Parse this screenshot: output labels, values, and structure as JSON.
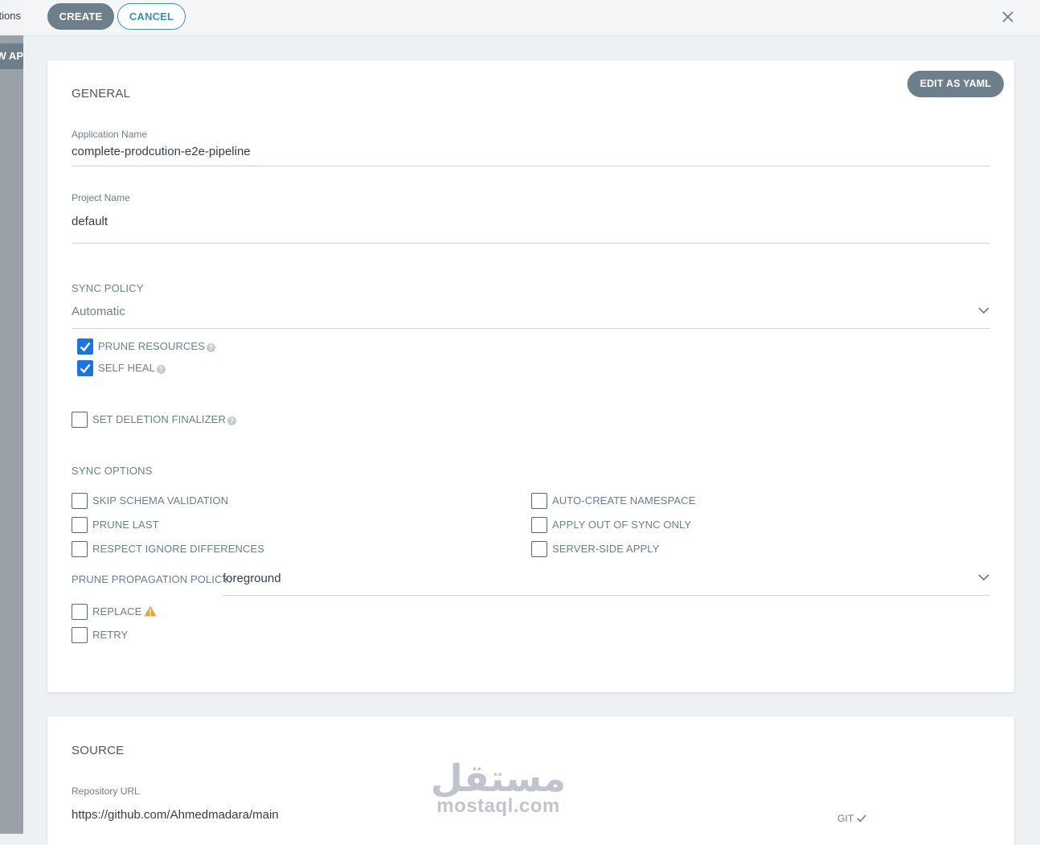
{
  "sidebar": {
    "top_text": "tions",
    "button_text": "W AP"
  },
  "toolbar": {
    "create_label": "CREATE",
    "cancel_label": "CANCEL"
  },
  "general": {
    "title": "GENERAL",
    "edit_yaml_label": "EDIT AS YAML",
    "application_name": {
      "label": "Application Name",
      "value": "complete-prodcution-e2e-pipeline"
    },
    "project_name": {
      "label": "Project Name",
      "value": "default"
    },
    "sync_policy": {
      "title": "SYNC POLICY",
      "selected": "Automatic",
      "prune_resources": {
        "label": "PRUNE RESOURCES",
        "checked": true
      },
      "self_heal": {
        "label": "SELF HEAL",
        "checked": true
      }
    },
    "set_deletion_finalizer": {
      "label": "SET DELETION FINALIZER",
      "checked": false
    },
    "sync_options": {
      "title": "SYNC OPTIONS",
      "left": [
        {
          "label": "SKIP SCHEMA VALIDATION",
          "checked": false
        },
        {
          "label": "PRUNE LAST",
          "checked": false
        },
        {
          "label": "RESPECT IGNORE DIFFERENCES",
          "checked": false
        }
      ],
      "right": [
        {
          "label": "AUTO-CREATE NAMESPACE",
          "checked": false
        },
        {
          "label": "APPLY OUT OF SYNC ONLY",
          "checked": false
        },
        {
          "label": "SERVER-SIDE APPLY",
          "checked": false
        }
      ],
      "prune_propagation": {
        "label": "PRUNE PROPAGATION POLICY:",
        "value": "foreground"
      },
      "replace": {
        "label": "REPLACE",
        "checked": false
      },
      "retry": {
        "label": "RETRY",
        "checked": false
      }
    }
  },
  "source": {
    "title": "SOURCE",
    "repository_url": {
      "label": "Repository URL",
      "value": "https://github.com/Ahmedmadara/main"
    },
    "type_label": "GIT"
  },
  "watermark": {
    "arabic": "مستقل",
    "latin": "mostaql.com"
  },
  "colors": {
    "accent_blue": "#1a73e8",
    "button_gray": "#6d7f8b",
    "cancel_teal": "#3c8fb5",
    "warning": "#e9a23b"
  }
}
